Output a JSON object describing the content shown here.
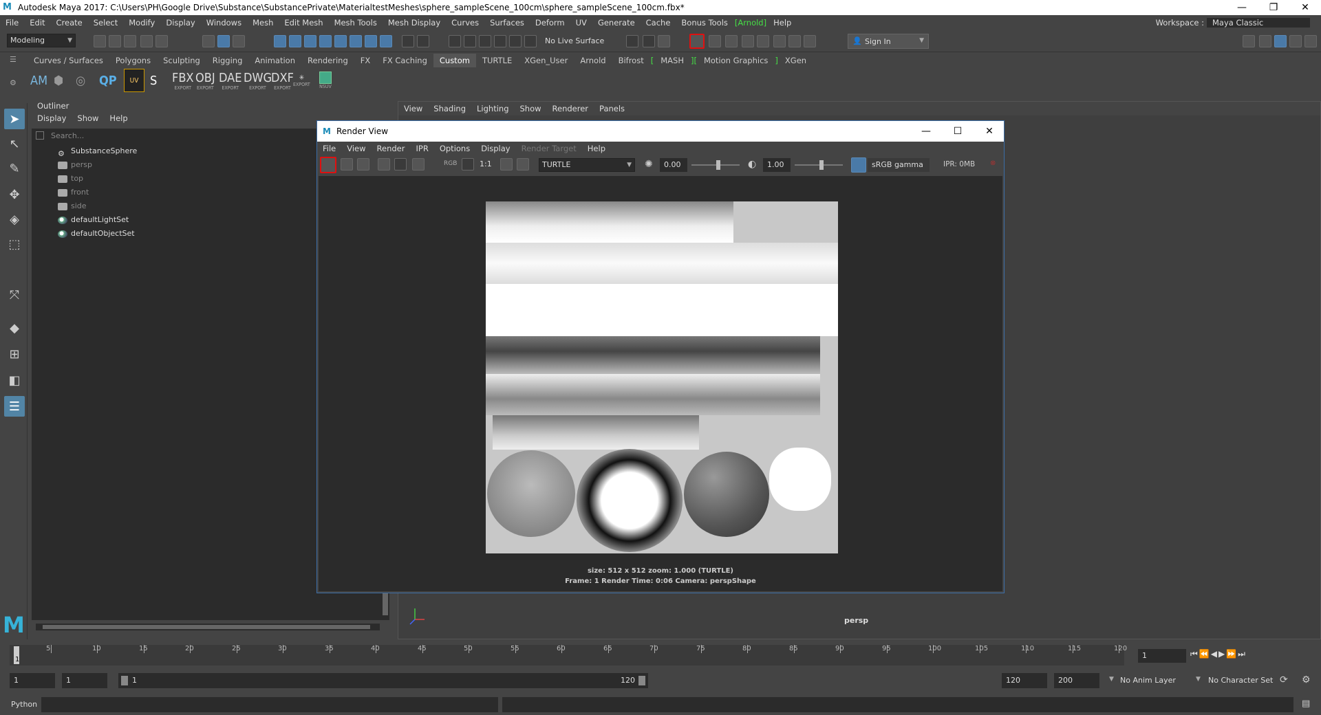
{
  "window": {
    "title": "Autodesk Maya 2017: C:\\Users\\PH\\Google Drive\\Substance\\SubstancePrivate\\MaterialtestMeshes\\sphere_sampleScene_100cm\\sphere_sampleScene_100cm.fbx*"
  },
  "menubar": {
    "items": [
      "File",
      "Edit",
      "Create",
      "Select",
      "Modify",
      "Display",
      "Windows",
      "Mesh",
      "Edit Mesh",
      "Mesh Tools",
      "Mesh Display",
      "Curves",
      "Surfaces",
      "Deform",
      "UV",
      "Generate",
      "Cache",
      "Bonus Tools"
    ],
    "arnold": "[Arnold]",
    "help": "Help",
    "workspace_label": "Workspace :",
    "workspace_value": "Maya Classic"
  },
  "statusline": {
    "mode": "Modeling",
    "live_surface": "No Live Surface",
    "sign_in": "Sign In"
  },
  "shelf": {
    "tabs": [
      "Curves / Surfaces",
      "Polygons",
      "Sculpting",
      "Rigging",
      "Animation",
      "Rendering",
      "FX",
      "FX Caching",
      "Custom",
      "TURTLE",
      "XGen_User",
      "Arnold",
      "Bifrost"
    ],
    "active_tab": "Custom",
    "green_tabs": [
      "MASH",
      "Motion Graphics"
    ],
    "last_tab": "XGen",
    "icons": [
      {
        "label": "AM",
        "sub": ""
      },
      {
        "label": "FBX",
        "sub": "EXPORT"
      },
      {
        "label": "OBJ",
        "sub": "EXPORT"
      },
      {
        "label": "DAE",
        "sub": "EXPORT"
      },
      {
        "label": "DWG",
        "sub": "EXPORT"
      },
      {
        "label": "DXF",
        "sub": "EXPORT"
      },
      {
        "label": "",
        "sub": "EXPORT"
      },
      {
        "label": "",
        "sub": "NSUV"
      }
    ]
  },
  "outliner": {
    "title": "Outliner",
    "menu": [
      "Display",
      "Show",
      "Help"
    ],
    "search_placeholder": "Search...",
    "items": [
      {
        "name": "SubstanceSphere",
        "icon": "group-icon",
        "dim": false
      },
      {
        "name": "persp",
        "icon": "camera-icon",
        "dim": true
      },
      {
        "name": "top",
        "icon": "camera-icon",
        "dim": true
      },
      {
        "name": "front",
        "icon": "camera-icon",
        "dim": true
      },
      {
        "name": "side",
        "icon": "camera-icon",
        "dim": true
      },
      {
        "name": "defaultLightSet",
        "icon": "set-icon",
        "dim": false
      },
      {
        "name": "defaultObjectSet",
        "icon": "set-icon",
        "dim": false
      }
    ]
  },
  "viewport": {
    "menu": [
      "View",
      "Shading",
      "Lighting",
      "Show",
      "Renderer",
      "Panels"
    ],
    "camera_label": "persp"
  },
  "render_view": {
    "title": "Render View",
    "menu": [
      "File",
      "View",
      "Render",
      "IPR",
      "Options",
      "Display"
    ],
    "render_target": "Render Target",
    "help": "Help",
    "rgb_label": "RGB",
    "ratio_label": "1:1",
    "renderer": "TURTLE",
    "exposure": "0.00",
    "gamma": "1.00",
    "color_space": "sRGB gamma",
    "ipr_mem": "IPR: 0MB",
    "info_line1": "size:  512 x 512  zoom: 1.000        (TURTLE)",
    "info_line2": "Frame: 1        Render Time: 0:06        Camera: perspShape"
  },
  "timeline": {
    "ticks": [
      "5",
      "10",
      "15",
      "20",
      "25",
      "30",
      "35",
      "40",
      "45",
      "50",
      "55",
      "60",
      "65",
      "70",
      "75",
      "80",
      "85",
      "90",
      "95",
      "100",
      "105",
      "110",
      "115",
      "120"
    ],
    "current_frame": "1",
    "frame_field": "1"
  },
  "range": {
    "start": "1",
    "start2": "1",
    "slider_start": "1",
    "slider_end": "120",
    "end": "120",
    "end2": "200",
    "anim_layer": "No Anim Layer",
    "char_set": "No Character Set"
  },
  "cmdline": {
    "label": "Python"
  },
  "colors": {
    "accent": "#5285a6",
    "highlight_red": "#e01010",
    "green": "#46e046"
  }
}
